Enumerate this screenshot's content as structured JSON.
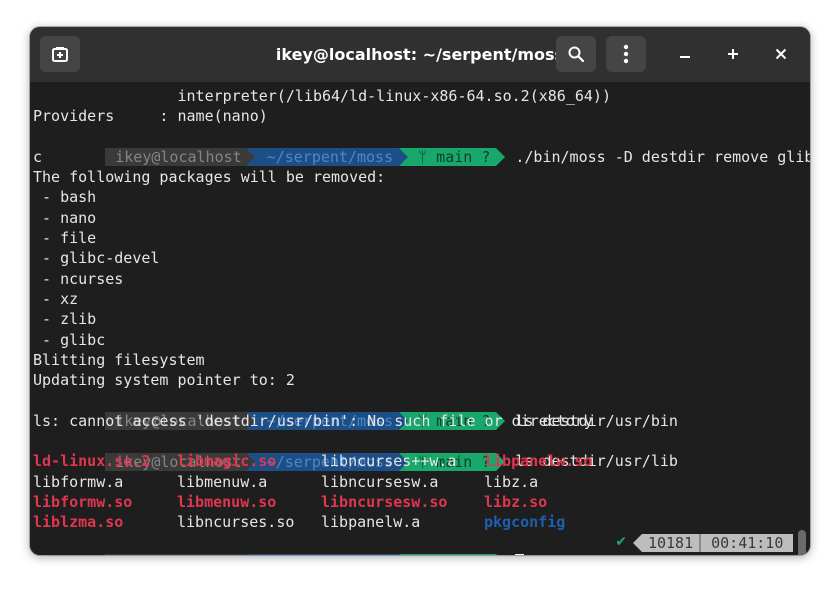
{
  "window": {
    "title": "ikey@localhost: ~/serpent/moss",
    "new_tab_label": "new-tab",
    "search_label": "search",
    "menu_label": "menu",
    "minimize_label": "minimize",
    "maximize_label": "maximize",
    "close_label": "close"
  },
  "prompt": {
    "user": "ikey@localhost",
    "dir": "~/serpent/moss",
    "git_branch_icon": "ᛘ",
    "git": "main ?"
  },
  "lines": {
    "l0": "                interpreter(/lib64/ld-linux-x86-64.so.2(x86_64))",
    "l1": "Providers     : name(nano)",
    "cmd1": "./bin/moss -D destdir remove glib",
    "l3": "c",
    "l4": "The following packages will be removed:",
    "pkgs": [
      " - bash",
      " - nano",
      " - file",
      " - glibc-devel",
      " - ncurses",
      " - xz",
      " - zlib",
      " - glibc"
    ],
    "l13": "Blitting filesystem",
    "l14": "Updating system pointer to: 2",
    "cmd2": "ls destdir/usr/bin",
    "l16": "ls: cannot access 'destdir/usr/bin': No such file or directory",
    "cmd3": "ls destdir/usr/lib"
  },
  "ls_output": [
    {
      "name": "ld-linux.so.2",
      "style": "red"
    },
    {
      "name": "libmagic.so",
      "style": "red"
    },
    {
      "name": "libncurses++w.a",
      "style": "plain"
    },
    {
      "name": "libpanelw.so",
      "style": "red"
    },
    {
      "name": "libformw.a",
      "style": "plain"
    },
    {
      "name": "libmenuw.a",
      "style": "plain"
    },
    {
      "name": "libncursesw.a",
      "style": "plain"
    },
    {
      "name": "libz.a",
      "style": "plain"
    },
    {
      "name": "libformw.so",
      "style": "red"
    },
    {
      "name": "libmenuw.so",
      "style": "red"
    },
    {
      "name": "libncursesw.so",
      "style": "red"
    },
    {
      "name": "libz.so",
      "style": "red"
    },
    {
      "name": "liblzma.so",
      "style": "red"
    },
    {
      "name": "libncurses.so",
      "style": "plain"
    },
    {
      "name": "libpanelw.a",
      "style": "plain"
    },
    {
      "name": "pkgconfig",
      "style": "blue"
    }
  ],
  "status": {
    "check": "✔",
    "history_number": "10181",
    "time": "00:41:10"
  },
  "colors": {
    "terminal_bg": "#1e1e1e",
    "headerbar_bg": "#303030",
    "prompt_user_bg": "#3a3a3a",
    "prompt_dir_bg": "#1d4e86",
    "prompt_git_bg": "#19a86b",
    "error_red": "#e0364f",
    "dir_blue": "#1d5fb0"
  }
}
